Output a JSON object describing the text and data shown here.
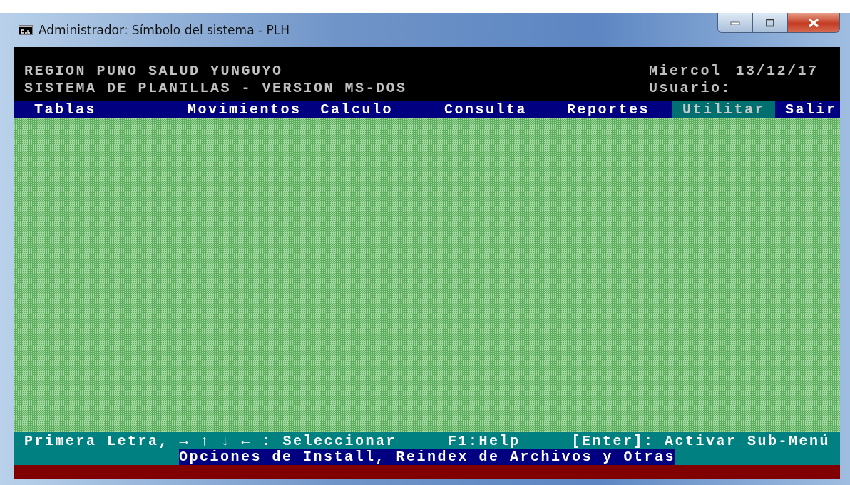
{
  "window": {
    "title": "Administrador: Símbolo del sistema - PLH"
  },
  "header": {
    "line_1": "REGION PUNO SALUD YUNGUYO",
    "line_2": "SISTEMA DE PLANILLAS - VERSION MS-DOS",
    "day": "Miercol",
    "date": "13/12/17",
    "user_label": "Usuario:"
  },
  "menu": [
    {
      "label": "Tablas",
      "selected": false
    },
    {
      "label": "Movimientos",
      "selected": false
    },
    {
      "label": "Calculo",
      "selected": false
    },
    {
      "label": "Consulta",
      "selected": false
    },
    {
      "label": "Reportes",
      "selected": false
    },
    {
      "label": "Utilitar",
      "selected": true
    },
    {
      "label": "Salir",
      "selected": false
    }
  ],
  "help": [
    "Primera Letra, → ↑ ↓ ← : Seleccionar",
    "F1:Help",
    "[Enter]: Activar Sub-Menú"
  ],
  "status": "Opciones de Install, Reindex de Archivos y Otras"
}
